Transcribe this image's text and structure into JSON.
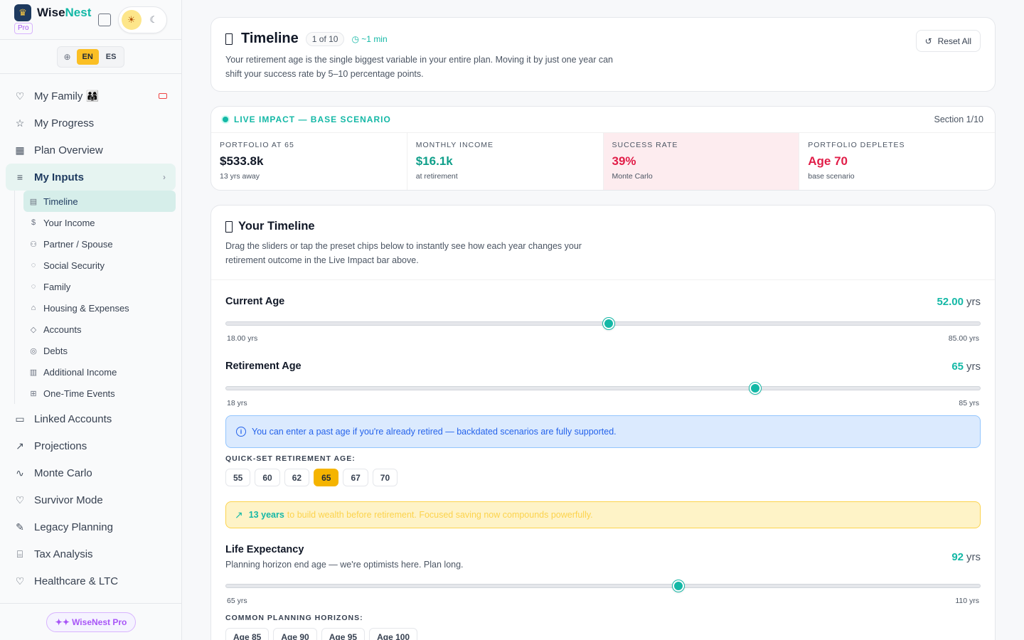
{
  "brand": {
    "name_a": "Wise",
    "name_b": "Nest",
    "tier": "Pro"
  },
  "lang": {
    "options": [
      "EN",
      "ES"
    ],
    "active": "EN"
  },
  "nav": {
    "top": [
      {
        "label": "My Family 👨‍👩‍👧",
        "icon": "heart-icon"
      },
      {
        "label": "My Progress",
        "icon": "star-icon"
      },
      {
        "label": "Plan Overview",
        "icon": "grid-icon"
      },
      {
        "label": "My Inputs",
        "icon": "sliders-icon"
      }
    ],
    "sub": [
      {
        "label": "Timeline",
        "icon": "calendar-icon"
      },
      {
        "label": "Your Income",
        "icon": "dollar-icon"
      },
      {
        "label": "Partner / Spouse",
        "icon": "users-icon"
      },
      {
        "label": "Social Security",
        "icon": "shield-icon"
      },
      {
        "label": "Family",
        "icon": "family-icon"
      },
      {
        "label": "Housing & Expenses",
        "icon": "home-icon"
      },
      {
        "label": "Accounts",
        "icon": "piggy-bank-icon"
      },
      {
        "label": "Debts",
        "icon": "debt-icon"
      },
      {
        "label": "Additional Income",
        "icon": "briefcase-icon"
      },
      {
        "label": "One-Time Events",
        "icon": "gift-icon"
      }
    ],
    "bottom": [
      {
        "label": "Linked Accounts",
        "icon": "bank-card-icon"
      },
      {
        "label": "Projections",
        "icon": "trend-up-icon"
      },
      {
        "label": "Monte Carlo",
        "icon": "activity-icon"
      },
      {
        "label": "Survivor Mode",
        "icon": "heart-icon"
      },
      {
        "label": "Legacy Planning",
        "icon": "scroll-icon"
      },
      {
        "label": "Tax Analysis",
        "icon": "landmark-icon"
      },
      {
        "label": "Healthcare & LTC",
        "icon": "heart-pulse-icon"
      }
    ],
    "footer_button": "✦✦ WiseNest Pro"
  },
  "header": {
    "title": "Timeline",
    "step": "1 of 10",
    "duration": "~1 min",
    "description": "Your retirement age is the single biggest variable in your entire plan. Moving it by just one year can shift your success rate by 5–10 percentage points.",
    "reset_label": "Reset All"
  },
  "impact": {
    "label": "LIVE IMPACT — BASE SCENARIO",
    "section": "Section 1/10",
    "metrics": [
      {
        "label": "PORTFOLIO AT 65",
        "value": "$533.8k",
        "sub": "13 yrs away"
      },
      {
        "label": "MONTHLY INCOME",
        "value": "$16.1k",
        "sub": "at retirement"
      },
      {
        "label": "SUCCESS RATE",
        "value": "39%",
        "sub": "Monte Carlo"
      },
      {
        "label": "PORTFOLIO DEPLETES",
        "value": "Age 70",
        "sub": "base scenario"
      }
    ]
  },
  "timeline": {
    "title": "Your Timeline",
    "description": "Drag the sliders or tap the preset chips below to instantly see how each year changes your retirement outcome in the Live Impact bar above.",
    "current_age": {
      "label": "Current Age",
      "value": "52.00",
      "unit": "yrs",
      "min": 18,
      "max": 85,
      "current": 52,
      "min_label": "18.00 yrs",
      "max_label": "85.00 yrs"
    },
    "retirement_age": {
      "label": "Retirement Age",
      "value": "65",
      "unit": "yrs",
      "min": 18,
      "max": 85,
      "current": 65,
      "min_label": "18 yrs",
      "max_label": "85 yrs"
    },
    "info": "You can enter a past age if you're already retired — backdated scenarios are fully supported.",
    "quick_label": "QUICK-SET RETIREMENT AGE:",
    "quick_chips": [
      "55",
      "60",
      "62",
      "65",
      "67",
      "70"
    ],
    "quick_active": "65",
    "warn_strong": "13 years",
    "warn_text": "to build wealth before retirement. Focused saving now compounds powerfully.",
    "life_expectancy": {
      "label": "Life Expectancy",
      "sub": "Planning horizon end age — we're optimists here. Plan long.",
      "value": "92",
      "unit": "yrs",
      "min": 65,
      "max": 110,
      "current": 92,
      "min_label": "65 yrs",
      "max_label": "110 yrs"
    },
    "horizon_label": "COMMON PLANNING HORIZONS:",
    "horizon_chips": [
      "Age 85",
      "Age 90",
      "Age 95",
      "Age 100"
    ]
  },
  "colors": {
    "accent": "#14b8a6",
    "brand": "#1e3a5f",
    "warn": "#f5b400",
    "danger": "#e11d48"
  }
}
